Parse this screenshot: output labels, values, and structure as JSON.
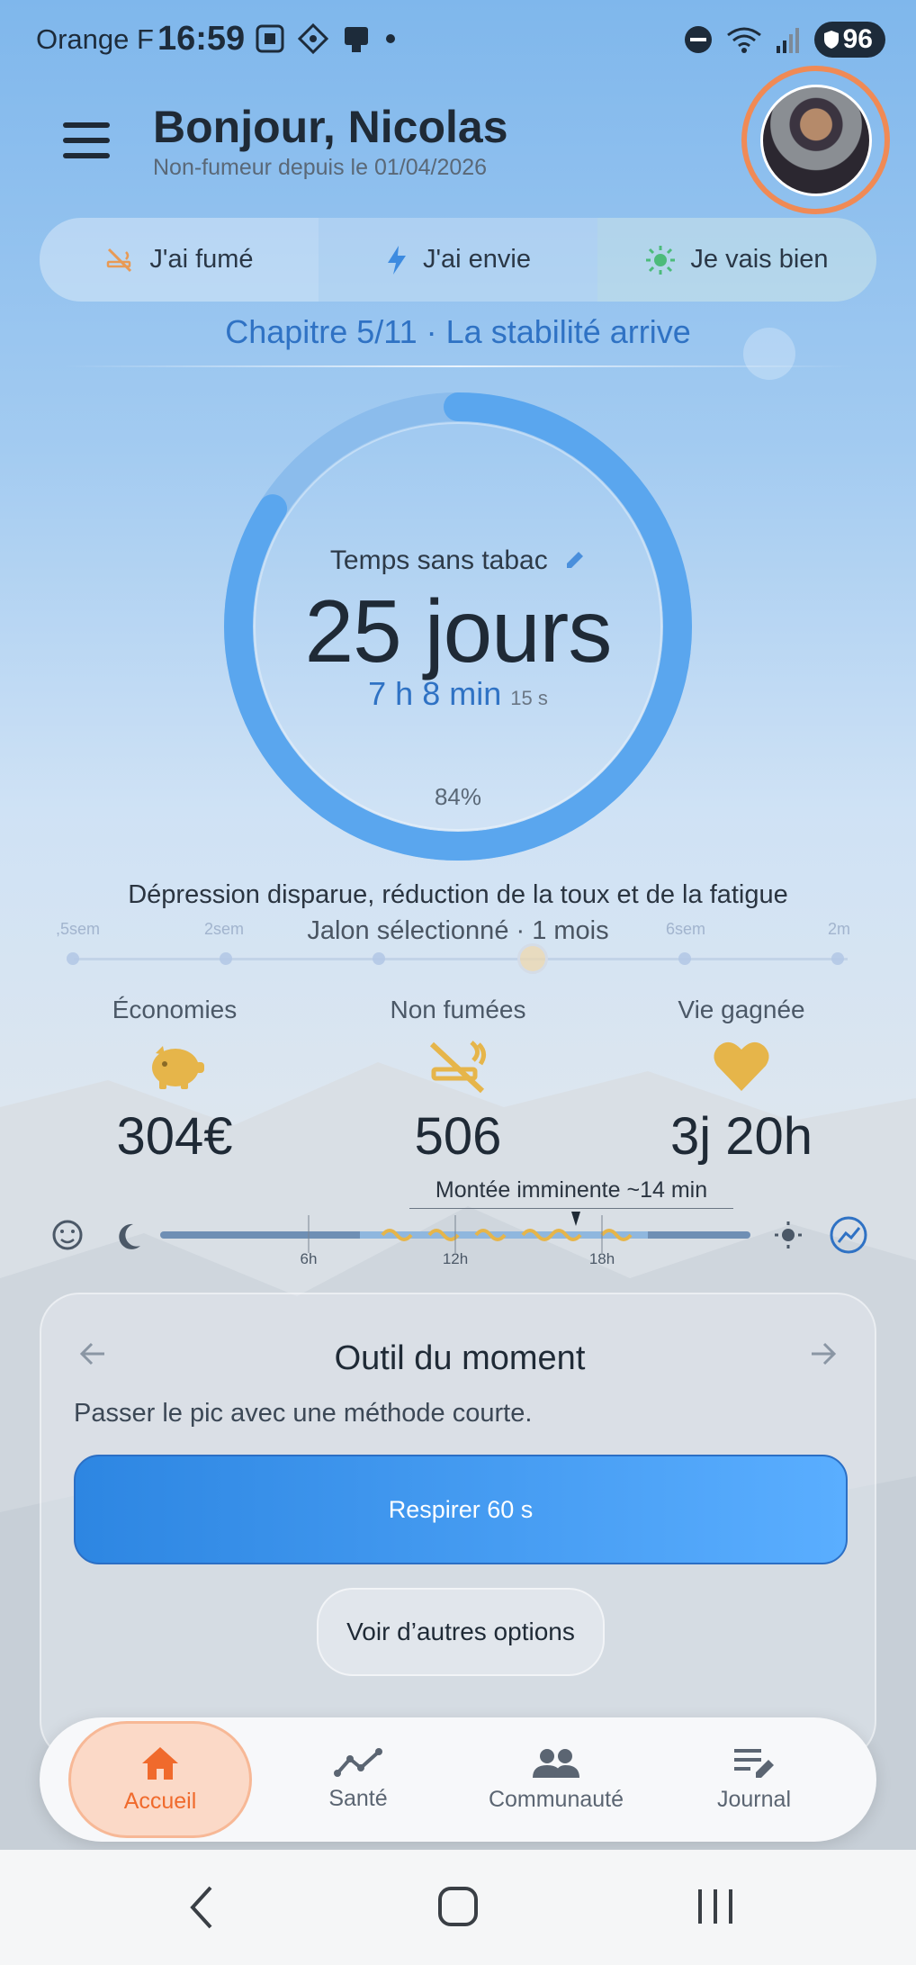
{
  "status_bar": {
    "carrier": "Orange F",
    "time": "16:59",
    "battery": "96"
  },
  "header": {
    "greeting": "Bonjour, Nicolas",
    "since": "Non-fumeur depuis le 01/04/2026"
  },
  "quick_actions": [
    {
      "label": "J'ai fumé",
      "icon": "no-smoking-icon"
    },
    {
      "label": "J'ai envie",
      "icon": "lightning-icon"
    },
    {
      "label": "Je vais bien",
      "icon": "sun-icon"
    }
  ],
  "chapter": "Chapitre 5/11 · La stabilité arrive",
  "timer": {
    "label": "Temps sans tabac",
    "days": "25 jours",
    "time": "7 h 8 min",
    "seconds": "15 s",
    "percent": "84%",
    "progress": 0.84
  },
  "milestone": {
    "text": "Dépression disparue, réduction de la toux et de la fatigue",
    "selected": "Jalon sélectionné · 1 mois",
    "labels": [
      ",5sem",
      "2sem",
      "",
      "",
      "6sem",
      "2m"
    ]
  },
  "stats": [
    {
      "label": "Économies",
      "value": "304€",
      "icon": "piggy-bank-icon"
    },
    {
      "label": "Non fumées",
      "value": "506",
      "icon": "no-smoking-icon"
    },
    {
      "label": "Vie gagnée",
      "value": "3j 20h",
      "icon": "heart-icon"
    }
  ],
  "craving": {
    "note": "Montée imminente ~14 min",
    "ticks": [
      "6h",
      "12h",
      "18h"
    ]
  },
  "tool": {
    "title": "Outil du moment",
    "subtitle": "Passer le pic avec une méthode courte.",
    "primary": "Respirer 60 s",
    "secondary": "Voir d’autres options"
  },
  "nav": [
    {
      "label": "Accueil",
      "icon": "home-icon",
      "active": true
    },
    {
      "label": "Santé",
      "icon": "trend-icon",
      "active": false
    },
    {
      "label": "Communauté",
      "icon": "group-icon",
      "active": false
    },
    {
      "label": "Journal",
      "icon": "journal-icon",
      "active": false
    }
  ],
  "colors": {
    "accent": "#2f72c4",
    "orange": "#f06a2c",
    "gold": "#e6b54a"
  }
}
